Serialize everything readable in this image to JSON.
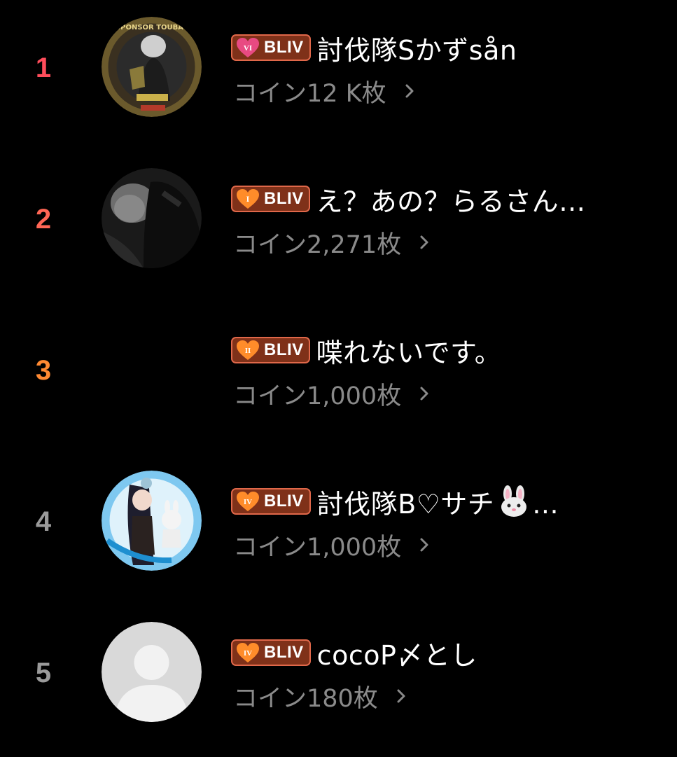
{
  "ranking": {
    "entries": [
      {
        "rank": "1",
        "rank_color": "#ff4d5b",
        "level_badge": {
          "numeral": "VI",
          "label": "BLIV",
          "heart_color": "#e84a82"
        },
        "username": "討伐隊Sかずsån",
        "coins_text": "コイン12 K枚",
        "avatar": "avatar-sponsor-emblem"
      },
      {
        "rank": "2",
        "rank_color": "#ff6655",
        "level_badge": {
          "numeral": "I",
          "label": "BLIV",
          "heart_color": "#ff8c2a"
        },
        "username": "え？あの？らるさん…",
        "coins_text": "コイン2,271枚",
        "avatar": "avatar-dark-photo"
      },
      {
        "rank": "3",
        "rank_color": "#ff8a33",
        "level_badge": {
          "numeral": "II",
          "label": "BLIV",
          "heart_color": "#ff8c2a"
        },
        "username": "喋れないです。",
        "coins_text": "コイン1,000枚",
        "avatar": "avatar-none"
      },
      {
        "rank": "4",
        "rank_color": "#9a9a9a",
        "level_badge": {
          "numeral": "IV",
          "label": "BLIV",
          "heart_color": "#ff8c2a"
        },
        "username_prefix": "討伐隊B♡サチ",
        "username_suffix": "...",
        "coins_text": "コイン1,000枚",
        "avatar": "avatar-anime-girl"
      },
      {
        "rank": "5",
        "rank_color": "#9a9a9a",
        "level_badge": {
          "numeral": "IV",
          "label": "BLIV",
          "heart_color": "#ff8c2a"
        },
        "username": "cocoP〆とし",
        "coins_text": "コイン180枚",
        "avatar": "avatar-default-placeholder"
      }
    ]
  },
  "colors": {
    "background": "#000000",
    "badge_fill": "#7f3119",
    "badge_border": "#e0684a",
    "coins_text": "#8a8a8a"
  }
}
